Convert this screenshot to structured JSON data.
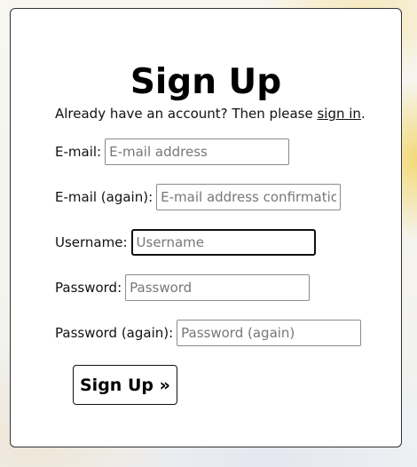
{
  "page": {
    "title": "Sign Up",
    "intro_prefix": "Already have an account? Then please ",
    "intro_link": "sign in",
    "intro_suffix": "."
  },
  "form": {
    "fields": [
      {
        "label": "E-mail:",
        "placeholder": "E-mail address",
        "value": ""
      },
      {
        "label": "E-mail (again):",
        "placeholder": "E-mail address confirmation",
        "value": ""
      },
      {
        "label": "Username:",
        "placeholder": "Username",
        "value": "",
        "focused": true
      },
      {
        "label": "Password:",
        "placeholder": "Password",
        "value": ""
      },
      {
        "label": "Password (again):",
        "placeholder": "Password (again)",
        "value": ""
      }
    ],
    "submit_label": "Sign Up »"
  },
  "colors": {
    "card_background": "#ffffff",
    "text": "#111111",
    "border": "#8a8a8a",
    "focus_border": "#111111"
  }
}
